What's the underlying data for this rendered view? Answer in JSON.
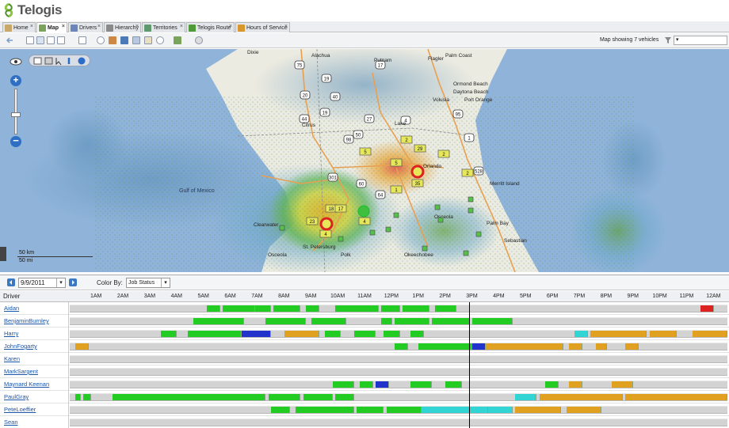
{
  "app": {
    "title": "Telogis"
  },
  "tabs": [
    {
      "label": "Home",
      "icon": "home-icon",
      "color": "#c9a86a",
      "active": false
    },
    {
      "label": "Map",
      "icon": "map-icon",
      "color": "#7aa45c",
      "active": true
    },
    {
      "label": "Drivers",
      "icon": "drivers-icon",
      "color": "#6b86b8",
      "active": false
    },
    {
      "label": "Hierarchy",
      "icon": "hierarchy-icon",
      "color": "#8a8a8a",
      "active": false
    },
    {
      "label": "Territories",
      "icon": "territories-icon",
      "color": "#5e9a6e",
      "active": false
    },
    {
      "label": "Telogis Route",
      "icon": "route-icon",
      "color": "#4f9b3a",
      "active": false
    },
    {
      "label": "Hours of Service",
      "icon": "hours-icon",
      "color": "#d9962b",
      "active": false
    }
  ],
  "toolbar": {
    "status": "Map showing 7 vehicles",
    "filter_value": "▾"
  },
  "map": {
    "scale_km": "50 km",
    "scale_mi": "50 mi",
    "labels": [
      "Dixie",
      "Alachua",
      "Putnam",
      "Flagler",
      "Palm Coast",
      "Ormond Beach",
      "Daytona Beach",
      "Port Orange",
      "Volusia",
      "Lake",
      "Citrus",
      "Orlando",
      "Osceola",
      "Merritt Island",
      "Gulf of Mexico",
      "Clearwater",
      "St. Petersburg",
      "Palm Bay",
      "Sebastian",
      "Okeechobee",
      "Osceola",
      "Polk"
    ],
    "highway_shields": [
      "75",
      "19",
      "20",
      "40",
      "19",
      "44",
      "50",
      "4",
      "98",
      "27",
      "60",
      "95",
      "1",
      "17",
      "301",
      "64",
      "528"
    ],
    "vehicle_badges": [
      "2",
      "29",
      "5",
      "2",
      "35",
      "4",
      "5",
      "1",
      "18",
      "23",
      "4",
      "17",
      "2"
    ]
  },
  "datebar": {
    "date": "9/9/2011",
    "color_by_label": "Color By:",
    "color_by_value": "Job Status"
  },
  "schedule": {
    "driver_header": "Driver",
    "hours": [
      "1AM",
      "2AM",
      "3AM",
      "4AM",
      "5AM",
      "6AM",
      "7AM",
      "8AM",
      "9AM",
      "10AM",
      "11AM",
      "12PM",
      "1PM",
      "2PM",
      "3PM",
      "4PM",
      "5PM",
      "6PM",
      "7PM",
      "8PM",
      "9PM",
      "10PM",
      "11PM",
      "12AM"
    ],
    "status_colors": {
      "completed": "#22cc22",
      "in_progress": "#2233cc",
      "scheduled": "#e0a020",
      "en_route": "#33d4d4",
      "overdue": "#dd2222",
      "idle": "#d3d3d3"
    },
    "drivers": [
      {
        "name": "Aidan",
        "segments": [
          [
            5.1,
            5.6,
            "completed"
          ],
          [
            5.7,
            6.9,
            "completed"
          ],
          [
            6.9,
            7.5,
            "completed"
          ],
          [
            7.6,
            8.6,
            "completed"
          ],
          [
            8.8,
            9.3,
            "completed"
          ],
          [
            9.9,
            11.5,
            "completed"
          ],
          [
            11.6,
            12.3,
            "completed"
          ],
          [
            12.4,
            13.4,
            "completed"
          ],
          [
            13.6,
            14.4,
            "completed"
          ],
          [
            23.5,
            24.0,
            "overdue"
          ]
        ]
      },
      {
        "name": "BenjaminBurnley",
        "segments": [
          [
            4.6,
            6.5,
            "completed"
          ],
          [
            7.3,
            8.8,
            "completed"
          ],
          [
            9.0,
            10.3,
            "completed"
          ],
          [
            11.6,
            12.0,
            "completed"
          ],
          [
            12.1,
            13.4,
            "completed"
          ],
          [
            13.5,
            14.9,
            "completed"
          ],
          [
            15.0,
            16.5,
            "completed"
          ]
        ]
      },
      {
        "name": "Harry",
        "segments": [
          [
            3.4,
            4.0,
            "completed"
          ],
          [
            4.4,
            6.4,
            "completed"
          ],
          [
            6.4,
            7.5,
            "in_progress"
          ],
          [
            8.0,
            9.3,
            "scheduled"
          ],
          [
            9.5,
            10.1,
            "completed"
          ],
          [
            10.6,
            11.4,
            "completed"
          ],
          [
            11.7,
            12.3,
            "completed"
          ],
          [
            12.7,
            13.2,
            "completed"
          ],
          [
            18.8,
            19.3,
            "en_route"
          ],
          [
            19.4,
            21.5,
            "scheduled"
          ],
          [
            21.6,
            22.6,
            "scheduled"
          ],
          [
            23.2,
            24.5,
            "scheduled"
          ]
        ]
      },
      {
        "name": "JohnFogarty",
        "segments": [
          [
            0.2,
            0.7,
            "scheduled"
          ],
          [
            12.1,
            12.6,
            "completed"
          ],
          [
            13.0,
            15.0,
            "completed"
          ],
          [
            15.0,
            15.5,
            "in_progress"
          ],
          [
            15.5,
            18.4,
            "scheduled"
          ],
          [
            18.6,
            19.1,
            "scheduled"
          ],
          [
            19.6,
            20.0,
            "scheduled"
          ],
          [
            20.7,
            21.2,
            "scheduled"
          ]
        ]
      },
      {
        "name": "Karen",
        "segments": []
      },
      {
        "name": "MarkSargent",
        "segments": []
      },
      {
        "name": "Maynard Keenan",
        "segments": [
          [
            9.8,
            10.6,
            "completed"
          ],
          [
            10.8,
            11.3,
            "completed"
          ],
          [
            11.4,
            11.9,
            "in_progress"
          ],
          [
            12.7,
            13.5,
            "completed"
          ],
          [
            14.0,
            14.6,
            "completed"
          ],
          [
            17.7,
            18.2,
            "completed"
          ],
          [
            18.6,
            19.1,
            "scheduled"
          ],
          [
            20.2,
            21.0,
            "scheduled"
          ]
        ]
      },
      {
        "name": "PaulGray",
        "segments": [
          [
            0.2,
            0.4,
            "completed"
          ],
          [
            0.5,
            0.8,
            "completed"
          ],
          [
            1.6,
            7.3,
            "completed"
          ],
          [
            7.4,
            8.6,
            "completed"
          ],
          [
            8.7,
            9.8,
            "completed"
          ],
          [
            9.9,
            10.6,
            "completed"
          ],
          [
            16.6,
            17.4,
            "en_route"
          ],
          [
            17.5,
            20.6,
            "scheduled"
          ],
          [
            20.7,
            24.5,
            "scheduled"
          ]
        ]
      },
      {
        "name": "PeteLoeffier",
        "segments": [
          [
            7.5,
            8.2,
            "completed"
          ],
          [
            8.4,
            10.6,
            "completed"
          ],
          [
            10.7,
            11.7,
            "completed"
          ],
          [
            11.8,
            13.1,
            "completed"
          ],
          [
            13.1,
            14.9,
            "en_route"
          ],
          [
            14.9,
            15.6,
            "en_route"
          ],
          [
            15.6,
            16.5,
            "en_route"
          ],
          [
            16.6,
            18.3,
            "scheduled"
          ],
          [
            18.5,
            19.8,
            "scheduled"
          ]
        ]
      },
      {
        "name": "Sean",
        "segments": []
      }
    ]
  }
}
